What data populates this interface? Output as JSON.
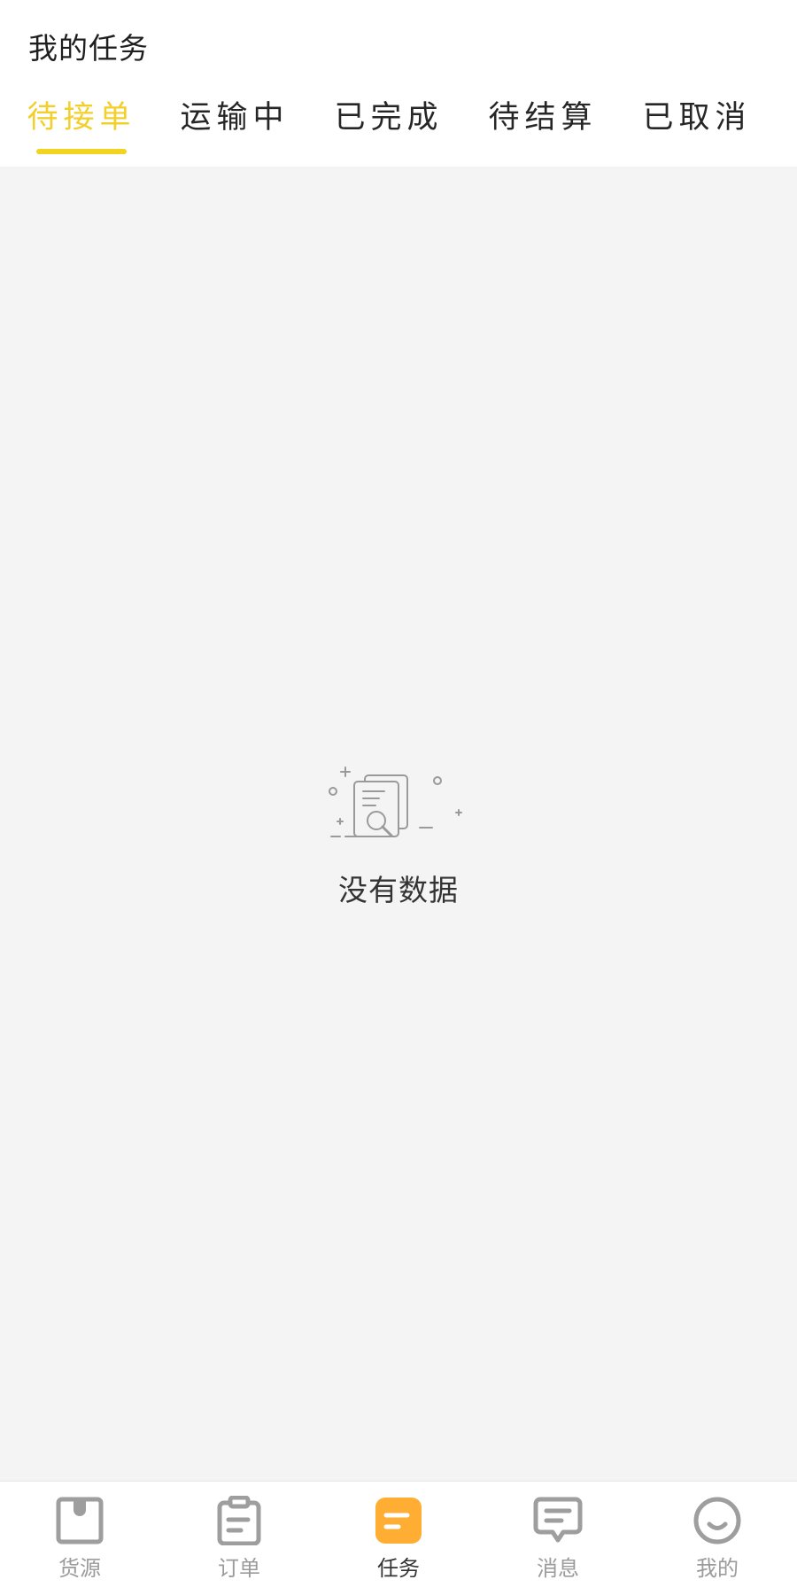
{
  "header": {
    "title": "我的任务"
  },
  "tabs": [
    {
      "label": "待接单",
      "active": true
    },
    {
      "label": "运输中",
      "active": false
    },
    {
      "label": "已完成",
      "active": false
    },
    {
      "label": "待结算",
      "active": false
    },
    {
      "label": "已取消",
      "active": false
    }
  ],
  "empty_state": {
    "icon": "empty-document-search-icon",
    "text": "没有数据"
  },
  "bottom_nav": [
    {
      "label": "货源",
      "icon": "box-icon",
      "active": false
    },
    {
      "label": "订单",
      "icon": "clipboard-icon",
      "active": false
    },
    {
      "label": "任务",
      "icon": "task-icon",
      "active": true
    },
    {
      "label": "消息",
      "icon": "message-icon",
      "active": false
    },
    {
      "label": "我的",
      "icon": "smile-icon",
      "active": false
    }
  ],
  "colors": {
    "accent": "#f2cf2a",
    "task_icon": "#ffad33",
    "content_bg": "#f4f4f4",
    "inactive_icon": "#9e9e9e"
  }
}
